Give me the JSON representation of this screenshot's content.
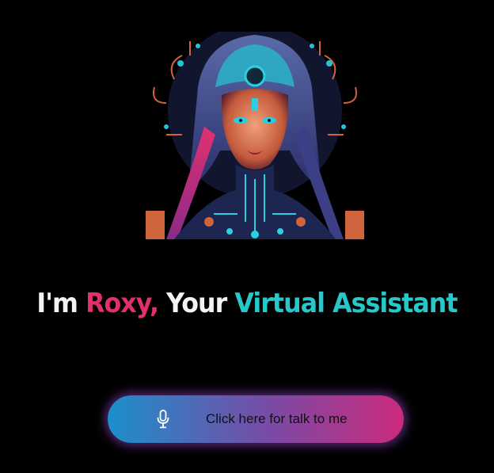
{
  "avatar": {
    "alt": ""
  },
  "headline": {
    "im": "I'm",
    "name": "Roxy,",
    "your": "Your",
    "role": "Virtual Assistant"
  },
  "talk_button": {
    "icon": "microphone-icon",
    "label": "Click here for talk to me"
  },
  "colors": {
    "background": "#000000",
    "name_accent": "#e0316d",
    "role_accent": "#26c8c9",
    "button_gradient_start": "#1c8fcb",
    "button_gradient_end": "#cc2a7c"
  }
}
